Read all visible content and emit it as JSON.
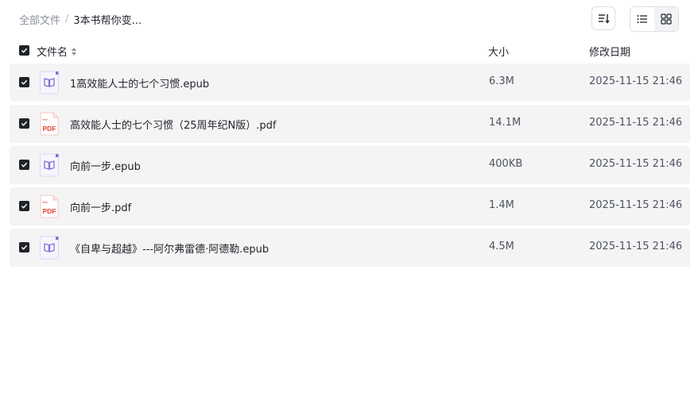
{
  "breadcrumb": {
    "root": "全部文件",
    "separator": "/",
    "current": "3本书帮你变..."
  },
  "header": {
    "name": "文件名",
    "size": "大小",
    "date": "修改日期"
  },
  "colors": {
    "epub_icon": "#7b73d8",
    "pdf_icon": "#e0463a",
    "row_bg": "#f4f4f5"
  },
  "files": [
    {
      "name": "1高效能人士的七个习惯.epub",
      "type": "epub",
      "size": "6.3M",
      "date": "2025-11-15 21:46"
    },
    {
      "name": "高效能人士的七个习惯（25周年纪N版）.pdf",
      "type": "pdf",
      "size": "14.1M",
      "date": "2025-11-15 21:46"
    },
    {
      "name": "向前一步.epub",
      "type": "epub",
      "size": "400KB",
      "date": "2025-11-15 21:46"
    },
    {
      "name": "向前一步.pdf",
      "type": "pdf",
      "size": "1.4M",
      "date": "2025-11-15 21:46"
    },
    {
      "name": "《自卑与超越》---阿尔弗雷德·阿德勒.epub",
      "type": "epub",
      "size": "4.5M",
      "date": "2025-11-15 21:46"
    }
  ],
  "icons": {
    "pdf_label": "PDF"
  }
}
